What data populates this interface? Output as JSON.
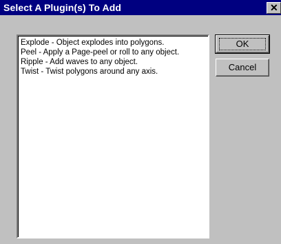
{
  "window": {
    "title": "Select A Plugin(s) To Add",
    "close_glyph": "✕"
  },
  "plugins": [
    "Explode - Object explodes into polygons.",
    "Peel - Apply a Page-peel or roll to any object.",
    "Ripple - Add waves to any object.",
    "Twist - Twist polygons around any axis."
  ],
  "buttons": {
    "ok_label": "OK",
    "cancel_label": "Cancel"
  },
  "colors": {
    "titlebar": "#000080",
    "face": "#c0c0c0"
  },
  "icons": {
    "close": "close-icon"
  }
}
